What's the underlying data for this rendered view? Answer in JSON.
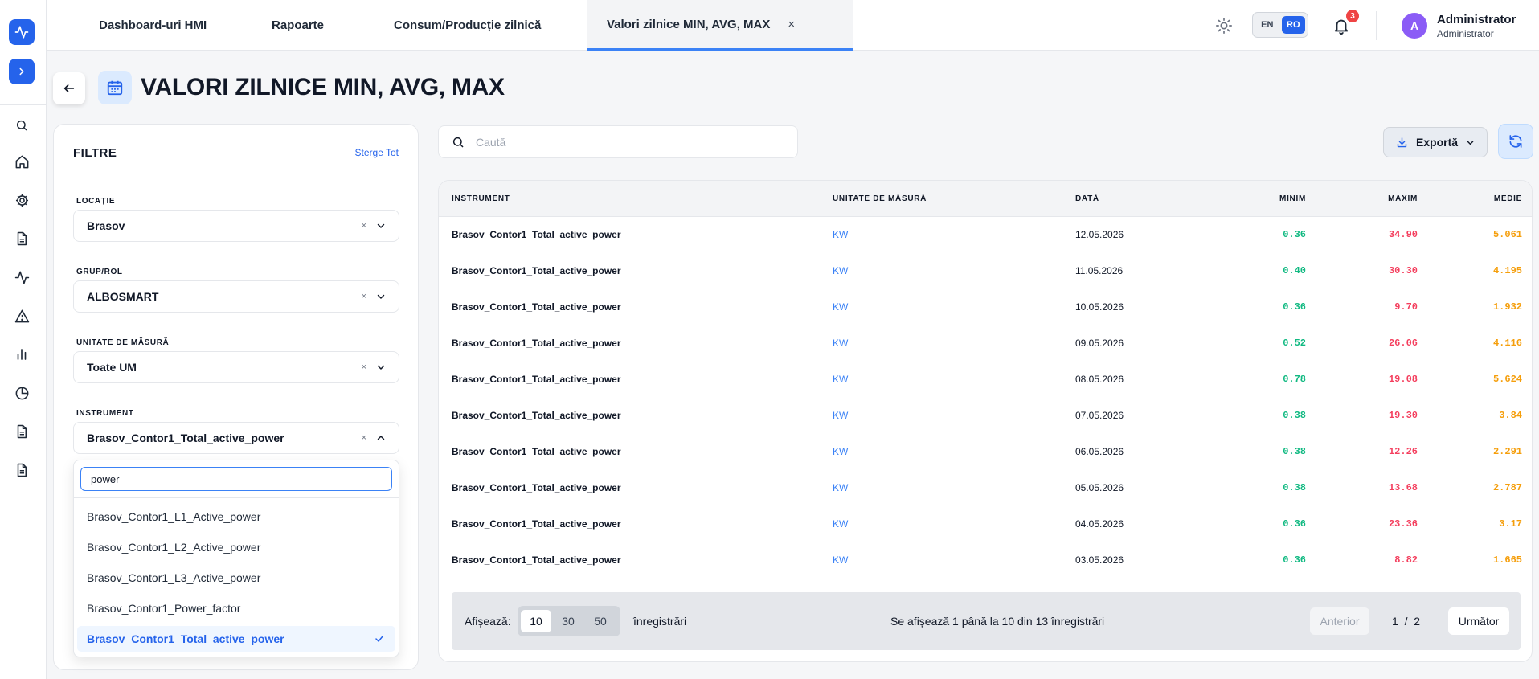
{
  "nav": {
    "logo_icon": "activity-icon",
    "expand_icon": "chevron-right-icon",
    "items": [
      "search-icon",
      "home-icon",
      "gear-icon",
      "document-icon",
      "activity-icon",
      "alert-icon",
      "bar-chart-icon",
      "pie-chart-icon",
      "document-icon",
      "document-icon"
    ]
  },
  "topbar": {
    "tabs": [
      {
        "label": "Dashboard-uri HMI"
      },
      {
        "label": "Rapoarte"
      },
      {
        "label": "Consum/Producție zilnică"
      },
      {
        "label": "Valori zilnice MIN, AVG, MAX",
        "active": true
      }
    ],
    "tab_close": "×",
    "lang": {
      "en": "EN",
      "ro": "RO",
      "selected": "RO"
    },
    "notifications_count": "3",
    "user": {
      "initial": "A",
      "name": "Administrator",
      "role": "Administrator"
    }
  },
  "page": {
    "title": "VALORI ZILNICE MIN, AVG, MAX"
  },
  "filters": {
    "title": "FILTRE",
    "clear_all": "Șterge Tot",
    "fields": [
      {
        "label": "LOCAȚIE",
        "value": "Brasov"
      },
      {
        "label": "GRUP/ROL",
        "value": "ALBOSMART"
      },
      {
        "label": "UNITATE DE MĂSURĂ",
        "value": "Toate UM"
      },
      {
        "label": "INSTRUMENT",
        "value": "Brasov_Contor1_Total_active_power"
      }
    ],
    "clear_mark": "×",
    "dropdown": {
      "search_value": "power",
      "options": [
        "Brasov_Contor1_L1_Active_power",
        "Brasov_Contor1_L2_Active_power",
        "Brasov_Contor1_L3_Active_power",
        "Brasov_Contor1_Power_factor",
        "Brasov_Contor1_Total_active_power"
      ],
      "selected": "Brasov_Contor1_Total_active_power"
    }
  },
  "toolbar": {
    "search_placeholder": "Caută",
    "export_label": "Exportă"
  },
  "table": {
    "columns": [
      "INSTRUMENT",
      "UNITATE DE MĂSURĂ",
      "DATĂ",
      "MINIM",
      "MAXIM",
      "MEDIE"
    ],
    "rows": [
      {
        "instrument": "Brasov_Contor1_Total_active_power",
        "unit": "KW",
        "date": "12.05.2026",
        "min": "0.36",
        "max": "34.90",
        "avg": "5.061"
      },
      {
        "instrument": "Brasov_Contor1_Total_active_power",
        "unit": "KW",
        "date": "11.05.2026",
        "min": "0.40",
        "max": "30.30",
        "avg": "4.195"
      },
      {
        "instrument": "Brasov_Contor1_Total_active_power",
        "unit": "KW",
        "date": "10.05.2026",
        "min": "0.36",
        "max": "9.70",
        "avg": "1.932"
      },
      {
        "instrument": "Brasov_Contor1_Total_active_power",
        "unit": "KW",
        "date": "09.05.2026",
        "min": "0.52",
        "max": "26.06",
        "avg": "4.116"
      },
      {
        "instrument": "Brasov_Contor1_Total_active_power",
        "unit": "KW",
        "date": "08.05.2026",
        "min": "0.78",
        "max": "19.08",
        "avg": "5.624"
      },
      {
        "instrument": "Brasov_Contor1_Total_active_power",
        "unit": "KW",
        "date": "07.05.2026",
        "min": "0.38",
        "max": "19.30",
        "avg": "3.84"
      },
      {
        "instrument": "Brasov_Contor1_Total_active_power",
        "unit": "KW",
        "date": "06.05.2026",
        "min": "0.38",
        "max": "12.26",
        "avg": "2.291"
      },
      {
        "instrument": "Brasov_Contor1_Total_active_power",
        "unit": "KW",
        "date": "05.05.2026",
        "min": "0.38",
        "max": "13.68",
        "avg": "2.787"
      },
      {
        "instrument": "Brasov_Contor1_Total_active_power",
        "unit": "KW",
        "date": "04.05.2026",
        "min": "0.36",
        "max": "23.36",
        "avg": "3.17"
      },
      {
        "instrument": "Brasov_Contor1_Total_active_power",
        "unit": "KW",
        "date": "03.05.2026",
        "min": "0.36",
        "max": "8.82",
        "avg": "1.665"
      }
    ]
  },
  "pagination": {
    "show_label": "Afișează:",
    "page_sizes": [
      "10",
      "30",
      "50"
    ],
    "page_size_selected": "10",
    "records_label": "înregistrări",
    "info": "Se afișează 1 până la 10 din 13 înregistrări",
    "prev": "Anterior",
    "current_page": "1",
    "separator": "/",
    "total_pages": "2",
    "next": "Următor"
  },
  "colors": {
    "accent": "#2563eb",
    "min": "#10b981",
    "max": "#f43f5e",
    "avg": "#f59e0b"
  }
}
